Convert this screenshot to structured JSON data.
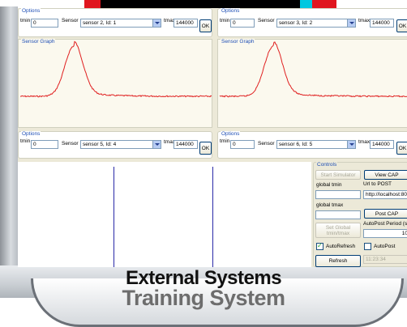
{
  "top_strip_colors": [
    "#e0161e",
    "#000000",
    "#00c8e0",
    "#e0161e"
  ],
  "options_panels": [
    {
      "title": "Options",
      "tmin_label": "tmin",
      "tmin_value": "0",
      "sensor_label": "Sensor",
      "sensor_value": "sensor 2, Id: 1",
      "tmax_label": "tmax",
      "tmax_value": "144000",
      "ok_label": "OK"
    },
    {
      "title": "Options",
      "tmin_label": "tmin",
      "tmin_value": "0",
      "sensor_label": "Sensor",
      "sensor_value": "sensor 3, Id: 2",
      "tmax_label": "tmax",
      "tmax_value": "144000",
      "ok_label": "OK"
    },
    {
      "title": "Options",
      "tmin_label": "tmin",
      "tmin_value": "0",
      "sensor_label": "Sensor",
      "sensor_value": "sensor 5, Id: 4",
      "tmax_label": "tmax",
      "tmax_value": "144000",
      "ok_label": "OK"
    },
    {
      "title": "Options",
      "tmin_label": "tmin",
      "tmin_value": "0",
      "sensor_label": "Sensor",
      "sensor_value": "sensor 6, Id: 5",
      "tmax_label": "tmax",
      "tmax_value": "144000",
      "ok_label": "OK"
    }
  ],
  "graphs": [
    {
      "title": "Sensor Graph",
      "line_color": "#e02020"
    },
    {
      "title": "Sensor Graph",
      "line_color": "#e02020"
    }
  ],
  "controls": {
    "title": "Controls",
    "start_simulator": "Start Simulator",
    "view_cap": "View CAP",
    "global_tmin_label": "global tmin",
    "global_tmin_value": "",
    "url_label": "Url to POST",
    "url_value": "http://localhost:800",
    "global_tmax_label": "global tmax",
    "global_tmax_value": "",
    "post_cap": "Post CAP",
    "set_global": "Set Global\ntmin/tmax",
    "autopost_period_label": "AutoPost Period (s)",
    "autopost_period_value": "10",
    "autorefresh_label": "AutoRefresh",
    "autopost_label": "AutoPost",
    "refresh": "Refresh",
    "time_value": "11:23:34"
  },
  "captions": {
    "back": "Training System",
    "front": "External Systems"
  }
}
